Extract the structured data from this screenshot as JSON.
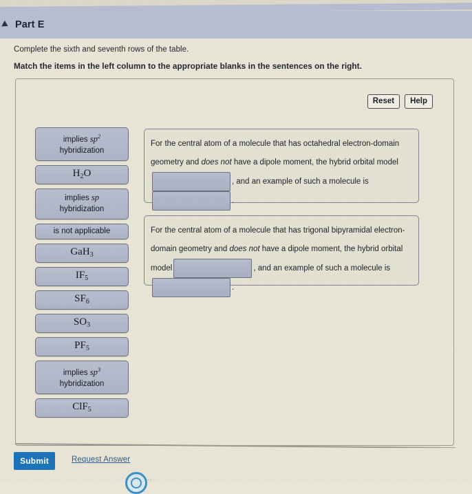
{
  "header": {
    "collapse_icon": "triangle-down-icon",
    "title": "Part E"
  },
  "instructions": {
    "line1": "Complete the sixth and seventh rows of the table.",
    "line2": "Match the items in the left column to the appropriate blanks in the sentences on the right."
  },
  "toolbar": {
    "reset_label": "Reset",
    "help_label": "Help"
  },
  "items": [
    {
      "id": "implies-sp2",
      "kind": "text",
      "pre": "implies ",
      "ital": "sp",
      "sup": "2",
      "line2": "hybridization"
    },
    {
      "id": "h2o",
      "kind": "formula",
      "main": "H",
      "sub": "2",
      "post": "O"
    },
    {
      "id": "implies-sp",
      "kind": "text",
      "pre": "implies ",
      "ital": "sp",
      "sup": "",
      "line2": "hybridization"
    },
    {
      "id": "not-applicable",
      "kind": "plain",
      "label": "is not applicable"
    },
    {
      "id": "gah3",
      "kind": "formula",
      "main": "GaH",
      "sub": "3",
      "post": ""
    },
    {
      "id": "if5",
      "kind": "formula",
      "main": "IF",
      "sub": "5",
      "post": ""
    },
    {
      "id": "sf6",
      "kind": "formula",
      "main": "SF",
      "sub": "6",
      "post": ""
    },
    {
      "id": "so3",
      "kind": "formula",
      "main": "SO",
      "sub": "3",
      "post": ""
    },
    {
      "id": "pf5",
      "kind": "formula",
      "main": "PF",
      "sub": "5",
      "post": ""
    },
    {
      "id": "implies-sp3",
      "kind": "text",
      "pre": "implies ",
      "ital": "sp",
      "sup": "3",
      "line2": "hybridization"
    },
    {
      "id": "clf5",
      "kind": "formula",
      "main": "ClF",
      "sub": "5",
      "post": ""
    }
  ],
  "sentences": [
    {
      "id": "octahedral",
      "part1": "For the central atom of a molecule that has octahedral electron-domain geometry and ",
      "emph": "does not",
      "part2": " have a dipole moment, the hybrid orbital model",
      "blank1": "",
      "part3": ", and an example of such a molecule is",
      "blank2": "",
      "part4": "."
    },
    {
      "id": "trigonal-bipyramidal",
      "part1": "For the central atom of a molecule that has trigonal bipyramidal electron-domain geometry and ",
      "emph": "does not",
      "part2": " have a dipole moment, the hybrid orbital model",
      "blank1": "",
      "part3": ", and an example of such a",
      "part3b": "molecule is",
      "blank2": "",
      "part4": "."
    }
  ],
  "footer": {
    "submit_label": "Submit",
    "request_answer_label": "Request Answer",
    "badge_icon": "circle-badge-icon",
    "badge_dots": ".."
  },
  "colors": {
    "header_bar": "#b9bdd2",
    "page_bg": "#e9e6d7",
    "item_bg": "#b3bac9",
    "submit_blue": "#1b74b8",
    "link_blue": "#2a5d8f"
  }
}
